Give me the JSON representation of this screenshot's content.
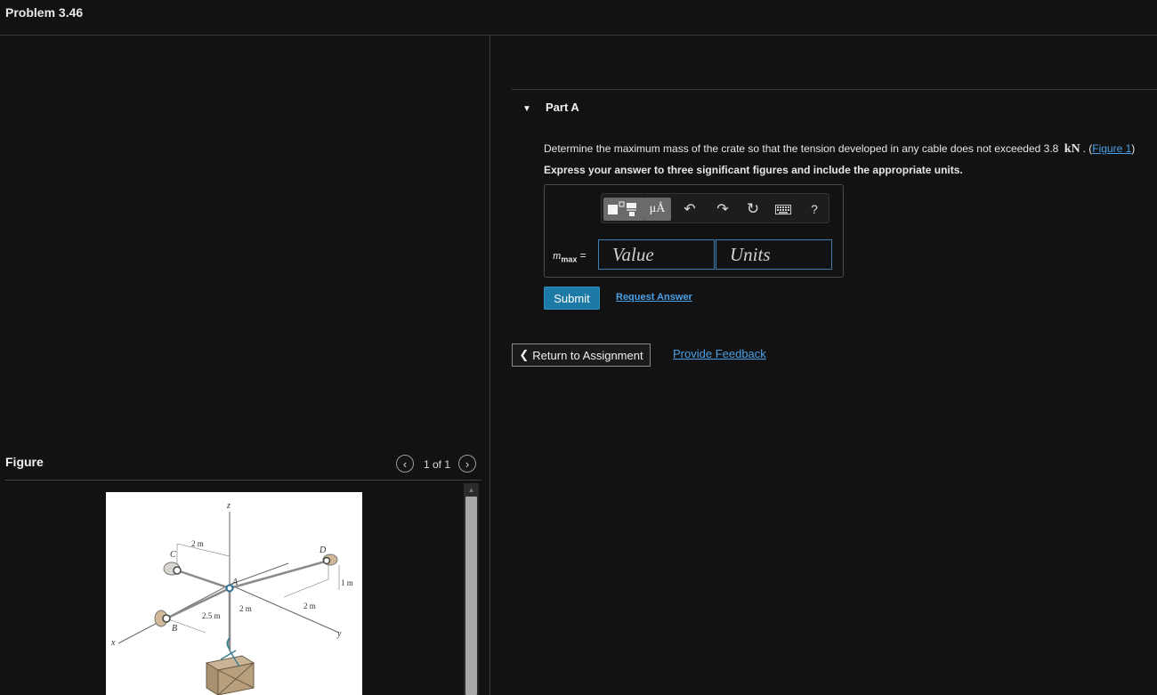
{
  "header": {
    "title": "Problem 3.46"
  },
  "figure_panel": {
    "heading": "Figure",
    "pager_text": "1 of 1",
    "prev_icon": "chevron-left-icon",
    "next_icon": "chevron-right-icon",
    "image_labels": {
      "z": "z",
      "x": "x",
      "y": "y",
      "A": "A",
      "B": "B",
      "C": "C",
      "D": "D",
      "dim_2m_top": "2 m",
      "dim_1m": "1 m",
      "dim_2_5m": "2.5 m",
      "dim_2m_mid": "2 m",
      "dim_2m_right": "2 m"
    }
  },
  "part_a": {
    "title": "Part A",
    "question_prefix": "Determine the maximum mass of the crate so that the tension developed in any cable does not exceeded 3.8",
    "question_unit": "kN",
    "question_suffix_open": ". (",
    "figure_link": "Figure 1",
    "question_suffix_close": ")",
    "instruction": "Express your answer to three significant figures and include the appropriate units.",
    "toolbar": {
      "units_symbol": "μÅ",
      "undo_icon": "undo-icon",
      "redo_icon": "redo-icon",
      "reset_icon": "reset-icon",
      "keyboard_icon": "keyboard-icon",
      "help_label": "?"
    },
    "variable": "m",
    "variable_sub": "max",
    "equals": "=",
    "value_placeholder": "Value",
    "units_placeholder": "Units",
    "submit_label": "Submit",
    "request_answer_label": "Request Answer"
  },
  "footer": {
    "return_label": "Return to Assignment",
    "feedback_label": "Provide Feedback"
  },
  "colors": {
    "accent": "#1d7aa6",
    "link": "#4aa0e6",
    "background": "#121212",
    "input_border": "#3f7fb5"
  }
}
